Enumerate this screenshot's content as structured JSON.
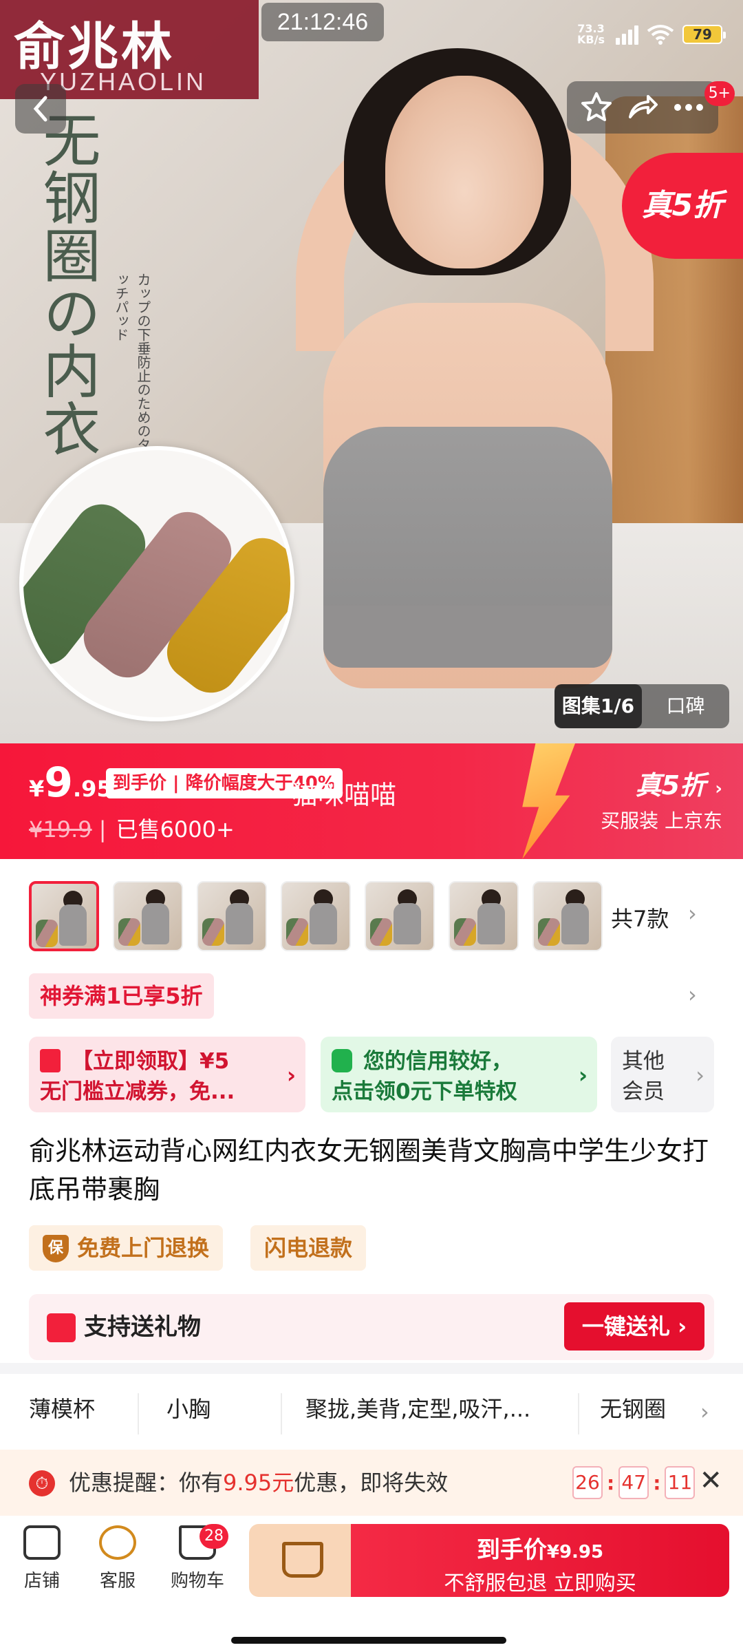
{
  "status_bar": {
    "time": "21:12:46",
    "net_speed": "73.3 KB/s",
    "net_type": "HD",
    "battery": "79"
  },
  "hero": {
    "brand_name": "俞兆林",
    "brand_sub": "YUZHAOLIN",
    "vertical_text": "无钢圈の内衣",
    "jp_text": "カップの下垂防止のためのタッチパッド",
    "discount_tag": "真5折",
    "nav_badge": "5+",
    "gallery_tab": "图集1/6",
    "review_tab": "口碑"
  },
  "price_bar": {
    "currency": "¥",
    "price_int": "9",
    "price_dec": ".95",
    "price_label": "到手价 | 降价幅度大于40%",
    "category_name": "猫咪喵喵",
    "original_price": "¥19.9",
    "sold": "已售6000+",
    "promo_title": "真5折",
    "promo_sub": "买服装 上京东"
  },
  "variants": {
    "count_label": "共7款"
  },
  "coupon_tag": "神券满1已享5折",
  "cards": {
    "coupon_l1": "【立即领取】¥5",
    "coupon_l2": "无门槛立减券，免...",
    "credit_l1": "您的信用较好，",
    "credit_l2": "点击领0元下单特权",
    "member_l1": "其他",
    "member_l2": "会员"
  },
  "product": {
    "title": "俞兆林运动背心网红内衣女无钢圈美背文胸高中学生少女打底吊带裹胸"
  },
  "services": {
    "free_return": "免费上门退换",
    "fast_refund": "闪电退款",
    "shield_char": "保"
  },
  "gift": {
    "label": "支持送礼物",
    "button": "一键送礼"
  },
  "attributes": [
    "薄模杯",
    "小胸",
    "聚拢,美背,定型,吸汗,...",
    "无钢圈"
  ],
  "reminder": {
    "prefix": "优惠提醒：你有",
    "amount": "9.95元",
    "suffix": "优惠，即将失效",
    "hh": "26",
    "mm": "47",
    "ss": "11"
  },
  "bottom": {
    "store": "店铺",
    "service": "客服",
    "cart": "购物车",
    "cart_badge": "28",
    "buy_l1_label": "到手价",
    "buy_l1_price": "¥9.95",
    "buy_l2_a": "不舒服包退",
    "buy_l2_b": "立即购买"
  },
  "colors": {
    "brand_red": "#f2203b",
    "brand_box": "#8b1d2e",
    "service_orange": "#c2701c",
    "credit_green": "#21b14d"
  }
}
